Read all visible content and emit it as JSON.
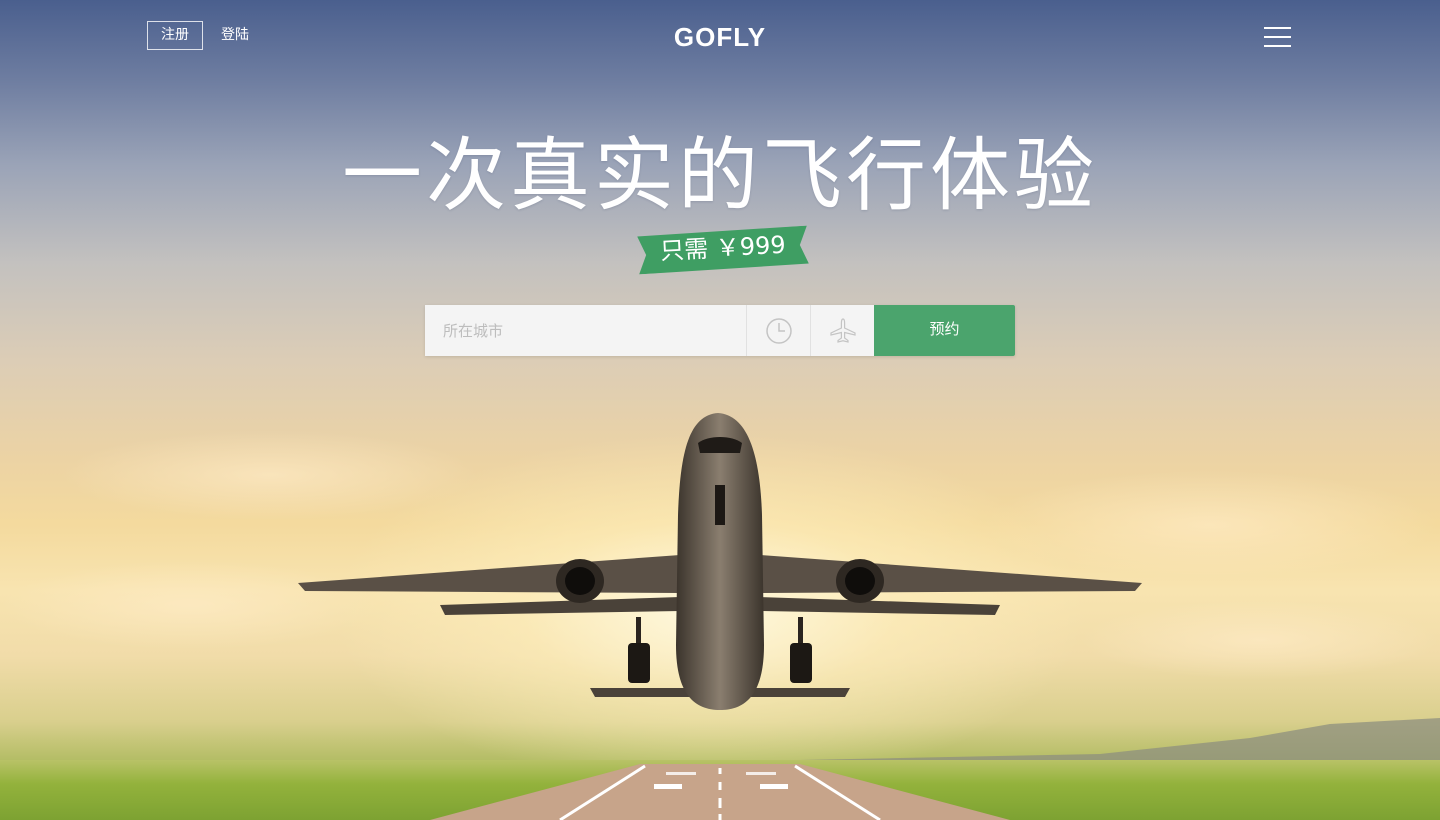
{
  "header": {
    "register_label": "注册",
    "login_label": "登陆",
    "logo_text": "GOFLY",
    "menu_icon": "hamburger-menu-icon"
  },
  "hero": {
    "title": "一次真实的飞行体验",
    "price_ribbon": "只需 ￥999"
  },
  "booking": {
    "city_placeholder": "所在城市",
    "city_value": "",
    "time_icon": "clock-icon",
    "flight_icon": "airplane-icon",
    "book_label": "预约"
  },
  "colors": {
    "accent_green": "#4ba46d",
    "ribbon_green": "#3f9e63",
    "input_bg": "#f4f4f4",
    "text_white": "#ffffff"
  }
}
